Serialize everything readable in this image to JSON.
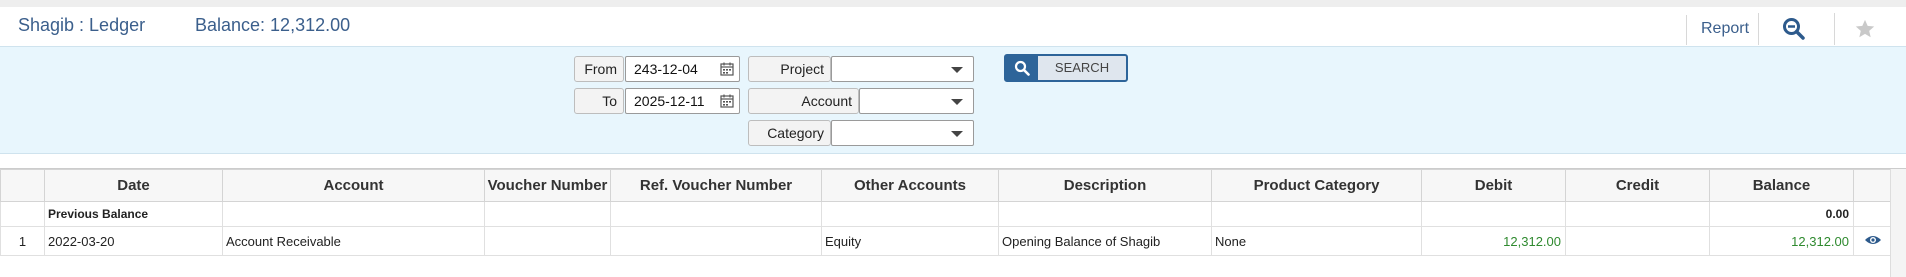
{
  "header": {
    "title": "Shagib : Ledger",
    "balance": "Balance: 12,312.00",
    "report_label": "Report",
    "zoom_icon": "zoom-out-icon",
    "star_icon": "star-icon"
  },
  "filters": {
    "from_label": "From",
    "from_value": "243-12-04",
    "to_label": "To",
    "to_value": "2025-12-11",
    "project_label": "Project",
    "project_value": "",
    "account_label": "Account",
    "account_value": "",
    "category_label": "Category",
    "category_value": "",
    "search_label": "SEARCH"
  },
  "table": {
    "columns": [
      "",
      "Date",
      "Account",
      "Voucher Number",
      "Ref. Voucher Number",
      "Other Accounts",
      "Description",
      "Product Category",
      "Debit",
      "Credit",
      "Balance",
      ""
    ],
    "previous_balance": {
      "label": "Previous Balance",
      "balance": "0.00"
    },
    "rows": [
      {
        "index": "1",
        "date": "2022-03-20",
        "account": "Account Receivable",
        "voucher_number": "",
        "ref_voucher_number": "",
        "other_accounts": "Equity",
        "description": "Opening Balance of Shagib",
        "product_category": "None",
        "debit": "12,312.00",
        "credit": "",
        "balance": "12,312.00"
      }
    ]
  },
  "colors": {
    "accent": "#3b5f8c",
    "button": "#2d6499",
    "panel_bg": "#e8f6fd",
    "amount_green": "#2f8a2f"
  }
}
